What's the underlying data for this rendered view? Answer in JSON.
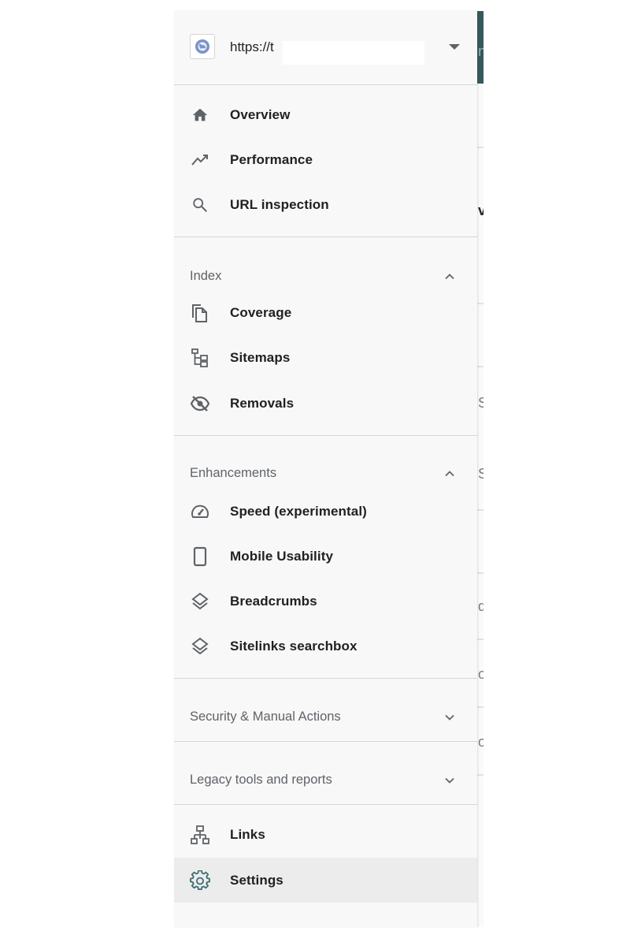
{
  "property": {
    "url_prefix": "https://t",
    "icon": "globe-icon"
  },
  "nav": {
    "overview": "Overview",
    "performance": "Performance",
    "url_inspection": "URL inspection"
  },
  "index": {
    "title": "Index",
    "coverage": "Coverage",
    "sitemaps": "Sitemaps",
    "removals": "Removals"
  },
  "enhancements": {
    "title": "Enhancements",
    "speed": "Speed (experimental)",
    "mobile_usability": "Mobile Usability",
    "breadcrumbs": "Breadcrumbs",
    "sitelinks_searchbox": "Sitelinks searchbox"
  },
  "security": {
    "title": "Security & Manual Actions"
  },
  "legacy": {
    "title": "Legacy tools and reports"
  },
  "bottom": {
    "links": "Links",
    "settings": "Settings"
  },
  "background_glyphs": [
    "n",
    "v",
    "S",
    "S",
    "d",
    "o",
    "o"
  ],
  "colors": {
    "drawer_bg": "#f8f8f8",
    "active_bg": "#ececec",
    "text": "#202124",
    "section_text": "#5f6368",
    "icon": "#5f6368",
    "header_dark": "#37595c"
  }
}
